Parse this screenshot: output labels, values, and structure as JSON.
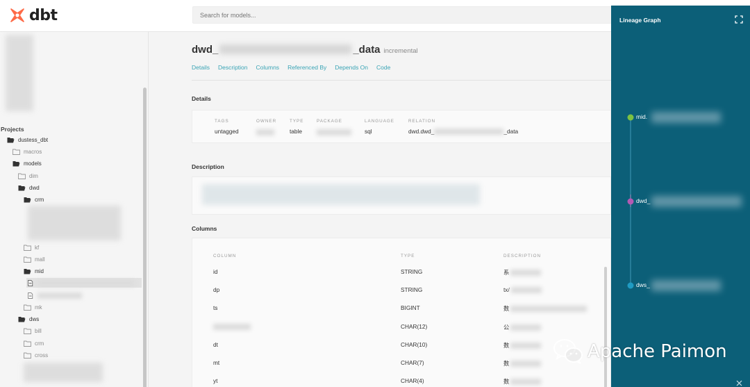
{
  "header": {
    "logo_text": "dbt",
    "search_placeholder": "Search for models..."
  },
  "sidebar": {
    "projects_label": "Projects",
    "tree": [
      {
        "label": "dustess_dbt",
        "state": "open"
      },
      {
        "label": "macros",
        "state": "closed"
      },
      {
        "label": "models",
        "state": "open"
      },
      {
        "label": "dim",
        "state": "closed"
      },
      {
        "label": "dwd",
        "state": "open"
      },
      {
        "label": "crm",
        "state": "open"
      },
      {
        "label": "kf",
        "state": "closed"
      },
      {
        "label": "mall",
        "state": "closed"
      },
      {
        "label": "mid",
        "state": "open"
      },
      {
        "label": "mk",
        "state": "closed"
      },
      {
        "label": "dws",
        "state": "open"
      },
      {
        "label": "bill",
        "state": "closed"
      },
      {
        "label": "crm",
        "state": "closed"
      },
      {
        "label": "cross",
        "state": "closed"
      }
    ]
  },
  "model": {
    "title_prefix": "dwd_",
    "title_suffix": "_data",
    "materialization": "incremental",
    "tabs": [
      "Details",
      "Description",
      "Columns",
      "Referenced By",
      "Depends On",
      "Code"
    ]
  },
  "details": {
    "section_title": "Details",
    "labels": {
      "tags": "TAGS",
      "owner": "OWNER",
      "type": "TYPE",
      "package": "PACKAGE",
      "language": "LANGUAGE",
      "relation": "RELATION"
    },
    "values": {
      "tags": "untagged",
      "type": "table",
      "language": "sql",
      "relation_prefix": "dwd.dwd_",
      "relation_suffix": "_data"
    }
  },
  "description": {
    "section_title": "Description"
  },
  "columns": {
    "section_title": "Columns",
    "headers": {
      "column": "COLUMN",
      "type": "TYPE",
      "description": "DESCRIPTION"
    },
    "rows": [
      {
        "name": "id",
        "type": "STRING",
        "desc": "系"
      },
      {
        "name": "dp",
        "type": "STRING",
        "desc": "tx/"
      },
      {
        "name": "ts",
        "type": "BIGINT",
        "desc": "数"
      },
      {
        "name": "",
        "type": "CHAR(12)",
        "desc": "公"
      },
      {
        "name": "dt",
        "type": "CHAR(10)",
        "desc": "数"
      },
      {
        "name": "mt",
        "type": "CHAR(7)",
        "desc": "数"
      },
      {
        "name": "yt",
        "type": "CHAR(4)",
        "desc": "数"
      }
    ]
  },
  "lineage": {
    "title": "Lineage Graph",
    "nodes": [
      {
        "label": "mid.",
        "color": "#7cc142"
      },
      {
        "label": "dwd_",
        "color": "#b45ab3"
      },
      {
        "label": "dws_",
        "color": "#1f9bc3"
      }
    ]
  },
  "watermark": {
    "text": "Apache Paimon"
  }
}
